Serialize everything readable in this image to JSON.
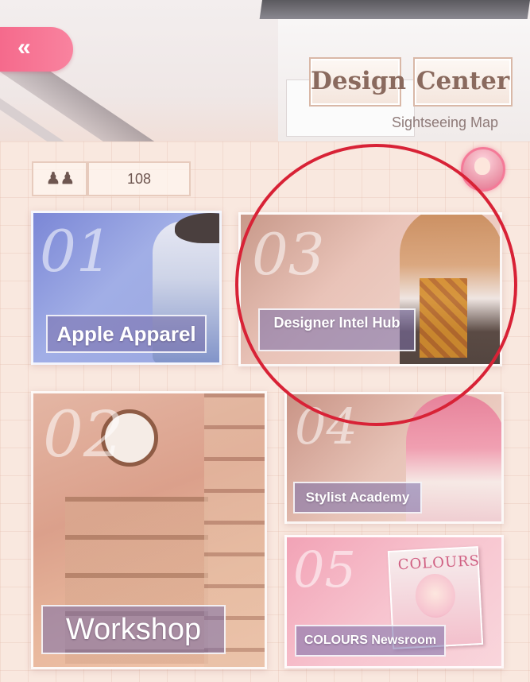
{
  "header": {
    "back_icon_glyph": "«",
    "title_part1": "Design",
    "title_part2": "Center",
    "subtitle": "Sightseeing Map"
  },
  "stats": {
    "icon": "people-icon",
    "icon_glyph": "♟♟",
    "value": "108"
  },
  "locations": [
    {
      "number": "01",
      "label": "Apple Apparel"
    },
    {
      "number": "02",
      "label": "Workshop"
    },
    {
      "number": "03",
      "label": "Designer Intel Hub"
    },
    {
      "number": "04",
      "label": "Stylist Academy"
    },
    {
      "number": "05",
      "label": "COLOURS Newsroom"
    }
  ],
  "magazine_cover_title": "COLOURS",
  "colors": {
    "back_button": "#f56a8c",
    "highlight_circle": "#d82236",
    "title_text": "#8a6a5e",
    "panel_bg": "#f9e8df"
  }
}
